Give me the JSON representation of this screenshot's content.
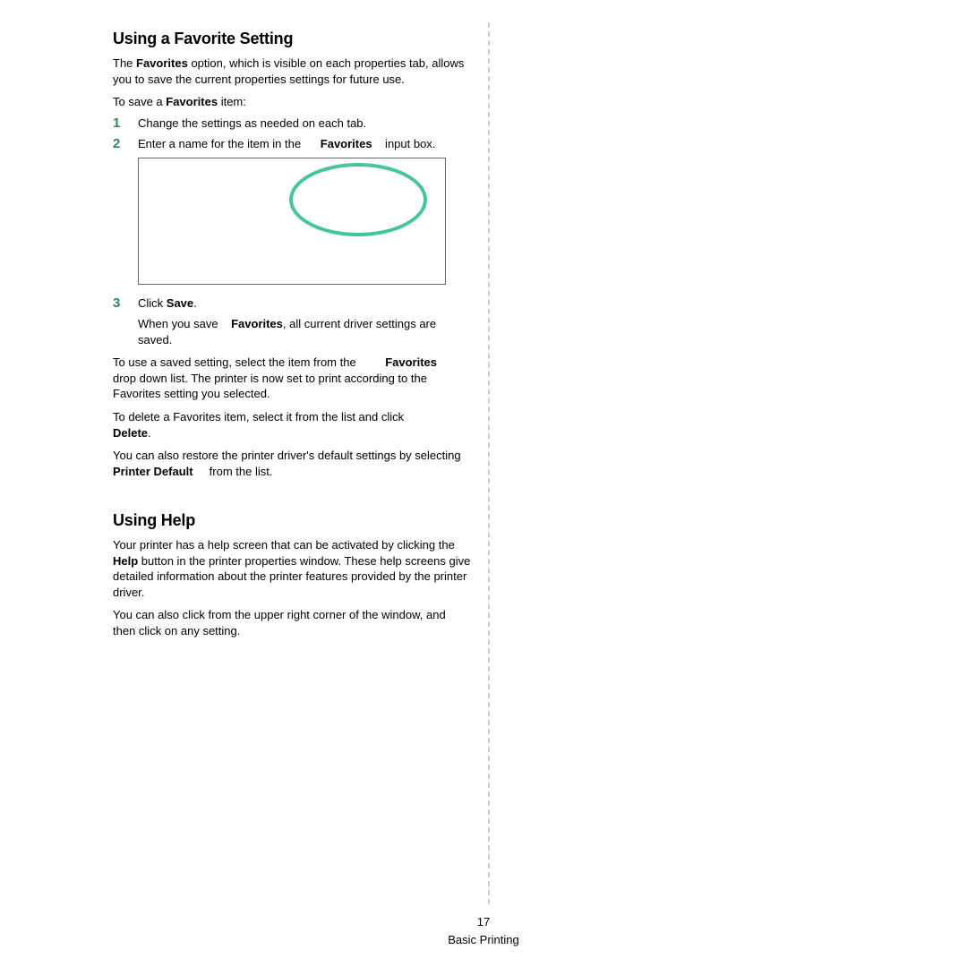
{
  "section1": {
    "heading": "Using a Favorite Setting",
    "intro_pre": "The ",
    "intro_bold": "Favorites",
    "intro_post": " option, which is visible on each properties tab, allows you to save the current properties settings for future use.",
    "save_pre": "To save a ",
    "save_bold": "Favorites",
    "save_post": " item:",
    "step1_num": "1",
    "step1_text": "Change the settings as needed on each tab.",
    "step2_num": "2",
    "step2_pre": "Enter a name for the item in the ",
    "step2_bold": "Favorites",
    "step2_post": " input box.",
    "step3_num": "3",
    "step3_pre": "Click ",
    "step3_bold": "Save",
    "step3_post": ".",
    "step3_sub_pre": "When you save ",
    "step3_sub_bold": "Favorites",
    "step3_sub_post": ", all current driver settings are saved.",
    "use_pre": "To use a saved setting, select the item from the ",
    "use_bold": "Favorites",
    "use_post": " drop down list. The printer is now set to print according to the Favorites setting you selected.",
    "delete_pre": "To delete a Favorites item, select it from the list and click ",
    "delete_bold": "Delete",
    "delete_post": ".",
    "restore_pre": "You can also restore the printer driver's default settings by selecting ",
    "restore_bold": "Printer Default",
    "restore_post": " from the list."
  },
  "section2": {
    "heading": "Using Help",
    "p1_pre": "Your printer has a help screen that can be activated by clicking the ",
    "p1_bold": "Help",
    "p1_post": " button in the printer properties window. These help screens give detailed information about the printer features provided by the printer driver.",
    "p2": "You can also click   from the upper right corner of the window, and then click on any setting."
  },
  "footer": {
    "page": "17",
    "title": "Basic Printing"
  }
}
